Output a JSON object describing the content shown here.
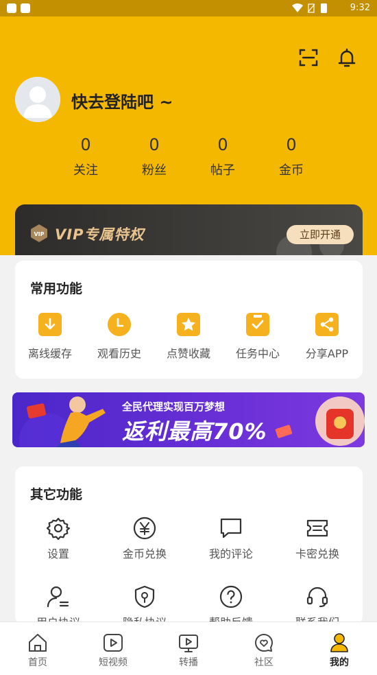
{
  "status_bar": {
    "time": "9:32"
  },
  "profile": {
    "login_prompt": "快去登陆吧 ~"
  },
  "stats": [
    {
      "value": "0",
      "label": "关注"
    },
    {
      "value": "0",
      "label": "粉丝"
    },
    {
      "value": "0",
      "label": "帖子"
    },
    {
      "value": "0",
      "label": "金币"
    }
  ],
  "vip": {
    "title": "VIP专属特权",
    "button": "立即开通",
    "badge_text": "VIP"
  },
  "common_functions": {
    "title": "常用功能",
    "items": [
      {
        "label": "离线缓存",
        "icon": "download-icon"
      },
      {
        "label": "观看历史",
        "icon": "clock-icon"
      },
      {
        "label": "点赞收藏",
        "icon": "star-icon"
      },
      {
        "label": "任务中心",
        "icon": "task-icon"
      },
      {
        "label": "分享APP",
        "icon": "share-icon"
      }
    ]
  },
  "banner": {
    "subtitle": "全民代理实现百万梦想",
    "headline": "返利最高70%"
  },
  "other_functions": {
    "title": "其它功能",
    "items": [
      {
        "label": "设置",
        "icon": "gear-icon"
      },
      {
        "label": "金币兑换",
        "icon": "yen-coin-icon"
      },
      {
        "label": "我的评论",
        "icon": "comment-icon"
      },
      {
        "label": "卡密兑换",
        "icon": "ticket-icon"
      },
      {
        "label": "用户协议",
        "icon": "user-agreement-icon"
      },
      {
        "label": "隐私协议",
        "icon": "privacy-shield-icon"
      },
      {
        "label": "帮助反馈",
        "icon": "help-icon"
      },
      {
        "label": "联系我们",
        "icon": "headset-icon"
      }
    ]
  },
  "tabbar": [
    {
      "label": "首页",
      "icon": "home-icon",
      "active": false
    },
    {
      "label": "短视频",
      "icon": "video-icon",
      "active": false
    },
    {
      "label": "转播",
      "icon": "broadcast-icon",
      "active": false
    },
    {
      "label": "社区",
      "icon": "community-icon",
      "active": false
    },
    {
      "label": "我的",
      "icon": "profile-icon",
      "active": true
    }
  ],
  "colors": {
    "brand": "#f5b800",
    "icon_orange": "#f6b21e",
    "vip_gold": "#e9c48f"
  }
}
